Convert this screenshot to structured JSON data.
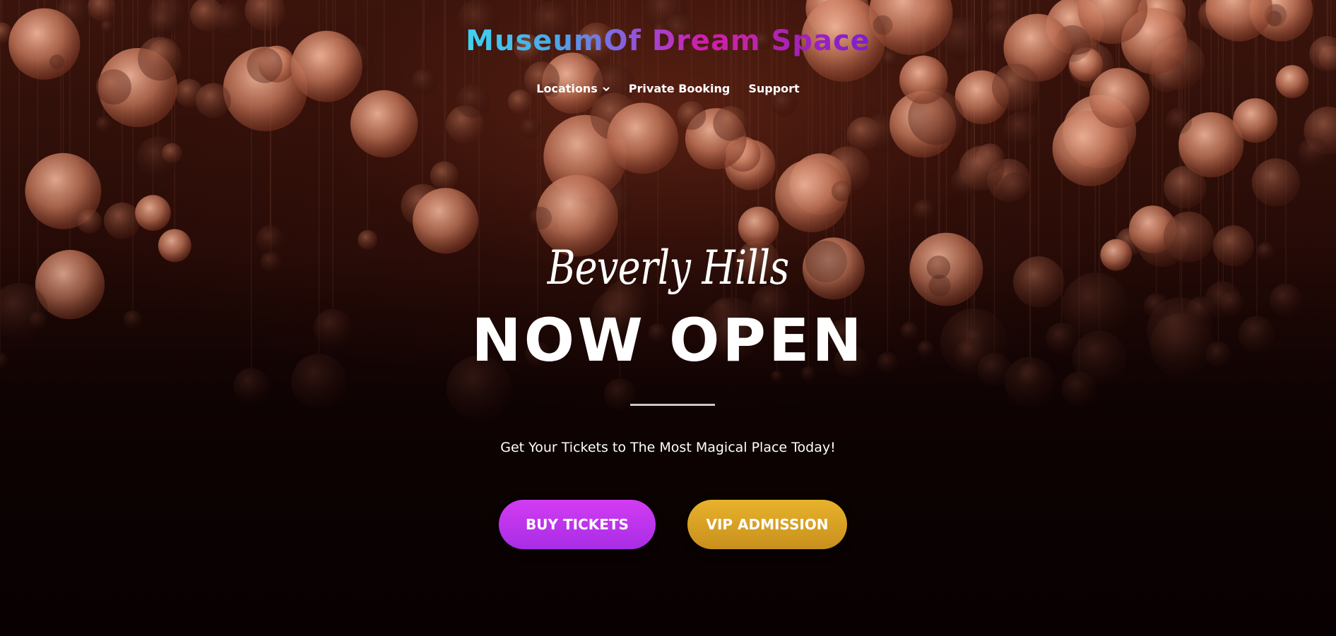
{
  "logo": {
    "text": "MuseumOf Dream Space"
  },
  "nav": {
    "items": [
      {
        "label": "Locations",
        "has_dropdown": true
      },
      {
        "label": "Private Booking",
        "has_dropdown": false
      },
      {
        "label": "Support",
        "has_dropdown": false
      }
    ]
  },
  "hero": {
    "subtitle": "Beverly Hills",
    "headline": "NOW OPEN",
    "tagline": "Get Your Tickets to The Most Magical Place Today!"
  },
  "buttons": {
    "buy_label": "BUY TICKETS",
    "vip_label": "VIP ADMISSION"
  },
  "colors": {
    "buy_button": "#b833ec",
    "vip_button": "#d9a226",
    "logo_gradient_start": "#3fd3f0",
    "logo_gradient_end": "#7a1fd0"
  },
  "icons": {
    "locations_dropdown": "chevron-down-icon"
  }
}
